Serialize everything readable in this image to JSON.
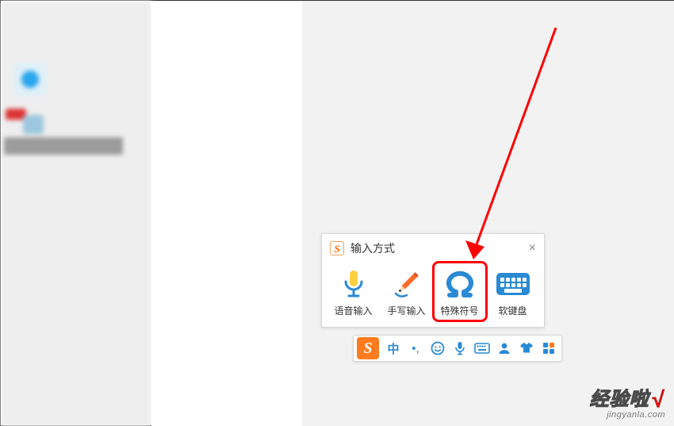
{
  "popup": {
    "title": "输入方式",
    "close_glyph": "×",
    "options": [
      {
        "id": "voice",
        "label": "语音输入",
        "icon": "microphone-icon"
      },
      {
        "id": "hand",
        "label": "手写输入",
        "icon": "pencil-icon"
      },
      {
        "id": "symbol",
        "label": "特殊符号",
        "icon": "omega-icon",
        "highlight": true
      },
      {
        "id": "softkb",
        "label": "软键盘",
        "icon": "keyboard-icon"
      }
    ]
  },
  "ime_bar": {
    "logo_glyph": "S",
    "items": [
      {
        "id": "lang",
        "label": "中",
        "icon": "lang-cn-icon"
      },
      {
        "id": "punct",
        "label": "•,",
        "icon": "punct-icon"
      },
      {
        "id": "emoji",
        "label": "☺",
        "icon": "emoji-icon"
      },
      {
        "id": "voice",
        "label": "🎤",
        "icon": "microphone-icon"
      },
      {
        "id": "keyboard",
        "label": "⌨",
        "icon": "keyboard-icon"
      },
      {
        "id": "user",
        "label": "👤",
        "icon": "user-icon"
      },
      {
        "id": "skin",
        "label": "👕",
        "icon": "skin-icon"
      },
      {
        "id": "toolbox",
        "label": "▦",
        "icon": "toolbox-icon"
      }
    ]
  },
  "sogou_badge_glyph": "S",
  "watermark": {
    "title": "经验啦",
    "check": "√",
    "url": "jingyanla.com"
  }
}
